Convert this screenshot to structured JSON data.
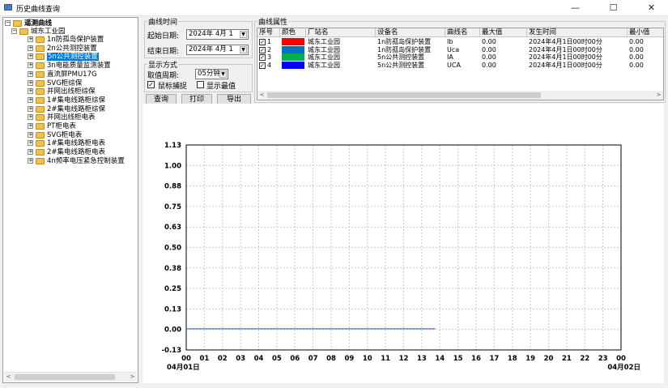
{
  "window": {
    "title": "历史曲线查询",
    "minimize": "—",
    "maximize": "☐",
    "close": "✕"
  },
  "tree": {
    "root_label": "遥测曲线",
    "station_label": "城东工业园",
    "items": [
      {
        "label": "1n防孤岛保护装置",
        "selected": false
      },
      {
        "label": "2n公共测控装置",
        "selected": false
      },
      {
        "label": "5n公共测控装置",
        "selected": true
      },
      {
        "label": "3n电能质量监测装置",
        "selected": false
      },
      {
        "label": "直流屏PMU17G",
        "selected": false
      },
      {
        "label": "SVG柜综保",
        "selected": false
      },
      {
        "label": "并网出线柜综保",
        "selected": false
      },
      {
        "label": "1#集电线路柜综保",
        "selected": false
      },
      {
        "label": "2#集电线路柜综保",
        "selected": false
      },
      {
        "label": "并网出线柜电表",
        "selected": false
      },
      {
        "label": "PT柜电表",
        "selected": false
      },
      {
        "label": "SVG柜电表",
        "selected": false
      },
      {
        "label": "1#集电线路柜电表",
        "selected": false
      },
      {
        "label": "2#集电线路柜电表",
        "selected": false
      },
      {
        "label": "4n频率电压紧急控制装置",
        "selected": false
      }
    ]
  },
  "time_group": {
    "title": "曲线时间",
    "start_label": "起始日期:",
    "start_value": "2024年 4月 1",
    "end_label": "结束日期:",
    "end_value": "2024年 4月 1"
  },
  "display_group": {
    "title": "显示方式",
    "period_label": "取值周期:",
    "period_value": "05分钟",
    "mouse_capture_label": "鼠标捕捉",
    "mouse_capture_checked": true,
    "show_max_label": "显示最值",
    "show_max_checked": false
  },
  "buttons": {
    "query": "查询",
    "print": "打印",
    "export": "导出"
  },
  "properties": {
    "title": "曲线属性",
    "columns": [
      "序号",
      "颜色",
      "厂站名",
      "设备名",
      "曲线名",
      "最大值",
      "发生时间",
      "最小值"
    ],
    "rows": [
      {
        "no": "1",
        "color": "#ff0000",
        "station": "城东工业园",
        "device": "1n防孤岛保护装置",
        "curve": "Ib",
        "max": "0.00",
        "time": "2024年4月1日00时00分",
        "min": "0.00"
      },
      {
        "no": "2",
        "color": "#0070c0",
        "station": "城东工业园",
        "device": "1n防孤岛保护装置",
        "curve": "Uca",
        "max": "0.00",
        "time": "2024年4月1日00时00分",
        "min": "0.00"
      },
      {
        "no": "3",
        "color": "#00b050",
        "station": "城东工业园",
        "device": "5n公共测控装置",
        "curve": "IA",
        "max": "0.00",
        "time": "2024年4月1日00时00分",
        "min": "0.00"
      },
      {
        "no": "4",
        "color": "#0000ff",
        "station": "城东工业园",
        "device": "5n公共测控装置",
        "curve": "UCA",
        "max": "0.00",
        "time": "2024年4月1日00时00分",
        "min": "0.00"
      }
    ]
  },
  "chart_data": {
    "type": "line",
    "y_ticks": [
      "1.13",
      "1.00",
      "0.88",
      "0.75",
      "0.63",
      "0.50",
      "0.38",
      "0.25",
      "0.13",
      "0.00",
      "-0.13"
    ],
    "ylim": [
      -0.13,
      1.13
    ],
    "x_ticks": [
      "00",
      "01",
      "02",
      "03",
      "04",
      "05",
      "06",
      "07",
      "08",
      "09",
      "10",
      "11",
      "12",
      "13",
      "14",
      "15",
      "16",
      "17",
      "18",
      "19",
      "20",
      "21",
      "22",
      "23",
      "00"
    ],
    "x_start_date": "04月01日",
    "x_end_date": "04月02日",
    "xlim": [
      0,
      24
    ],
    "grid": true,
    "series": [
      {
        "color": "#4f6fe0",
        "x": [
          0,
          13.75
        ],
        "values": [
          0,
          0
        ]
      }
    ]
  }
}
